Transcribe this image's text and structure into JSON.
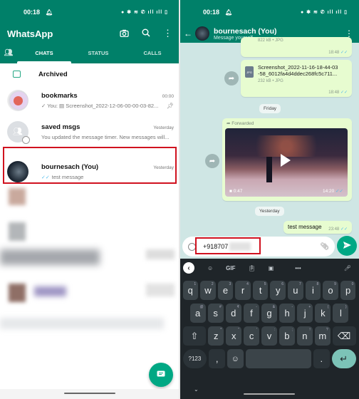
{
  "status_bar": {
    "time": "00:18",
    "right_icons": "● ✱ ≋ ✆ ıll ıll ▯"
  },
  "left": {
    "app_title": "WhatsApp",
    "header_icons": [
      "camera-icon",
      "search-icon",
      "more-icon"
    ],
    "tabs": [
      {
        "label": "CHATS",
        "active": true
      },
      {
        "label": "STATUS",
        "active": false
      },
      {
        "label": "CALLS",
        "active": false
      }
    ],
    "archived_label": "Archived",
    "chats": [
      {
        "name": "bookmarks",
        "time": "00:00",
        "preview": "✓ You: ▤ Screenshot_2022-12-06-00-00-03-82...",
        "pinned": true
      },
      {
        "name": "saved msgs",
        "time": "Yesterday",
        "preview": "You updated the message timer. New messages will..."
      },
      {
        "name": "bournesach (You)",
        "time": "Yesterday",
        "preview_tick": "✓✓",
        "preview": "test message",
        "highlighted": true
      }
    ],
    "fab_icon": "new-chat-icon"
  },
  "right": {
    "contact_name": "bournesach (You)",
    "contact_subtitle": "Message yourself",
    "messages": {
      "top_partial": {
        "size": "822 kB • JPG",
        "time": "18:48",
        "ticks": "✓✓"
      },
      "doc": {
        "icon_label": "JPG",
        "name_line1": "Screenshot_2022-11-16-18-44-03",
        "name_line2": "-58_6012fa4d4ddec268fc5c711...",
        "size": "232 kB • JPG",
        "time": "18:48",
        "ticks": "✓✓"
      },
      "date_friday": "Friday",
      "video": {
        "forwarded_label": "Forwarded",
        "duration": "0:47",
        "time": "14:20",
        "ticks": "✓✓"
      },
      "date_yesterday": "Yesterday",
      "text": {
        "body": "test message",
        "time": "23:48",
        "ticks": "✓✓"
      }
    },
    "input_value": "+918707",
    "keyboard": {
      "toolbar": {
        "gif": "GIF"
      },
      "row1": [
        [
          "q",
          "1"
        ],
        [
          "w",
          "2"
        ],
        [
          "e",
          "3"
        ],
        [
          "r",
          "4"
        ],
        [
          "t",
          "5"
        ],
        [
          "y",
          "6"
        ],
        [
          "u",
          "7"
        ],
        [
          "i",
          "8"
        ],
        [
          "o",
          "9"
        ],
        [
          "p",
          "0"
        ]
      ],
      "row2": [
        [
          "a",
          "@"
        ],
        [
          "s",
          "#"
        ],
        [
          "d",
          "₹"
        ],
        [
          "f",
          "-"
        ],
        [
          "g",
          "&"
        ],
        [
          "h",
          "-"
        ],
        [
          "j",
          "+"
        ],
        [
          "k",
          "("
        ],
        [
          "l",
          ")"
        ]
      ],
      "row3": [
        [
          "z",
          "*"
        ],
        [
          "x",
          "\""
        ],
        [
          "c",
          "'"
        ],
        [
          "v",
          ":"
        ],
        [
          "b",
          ";"
        ],
        [
          "n",
          "!"
        ],
        [
          "m",
          "?"
        ]
      ],
      "symbols_label": "?123",
      "comma": ",",
      "period": "."
    }
  }
}
